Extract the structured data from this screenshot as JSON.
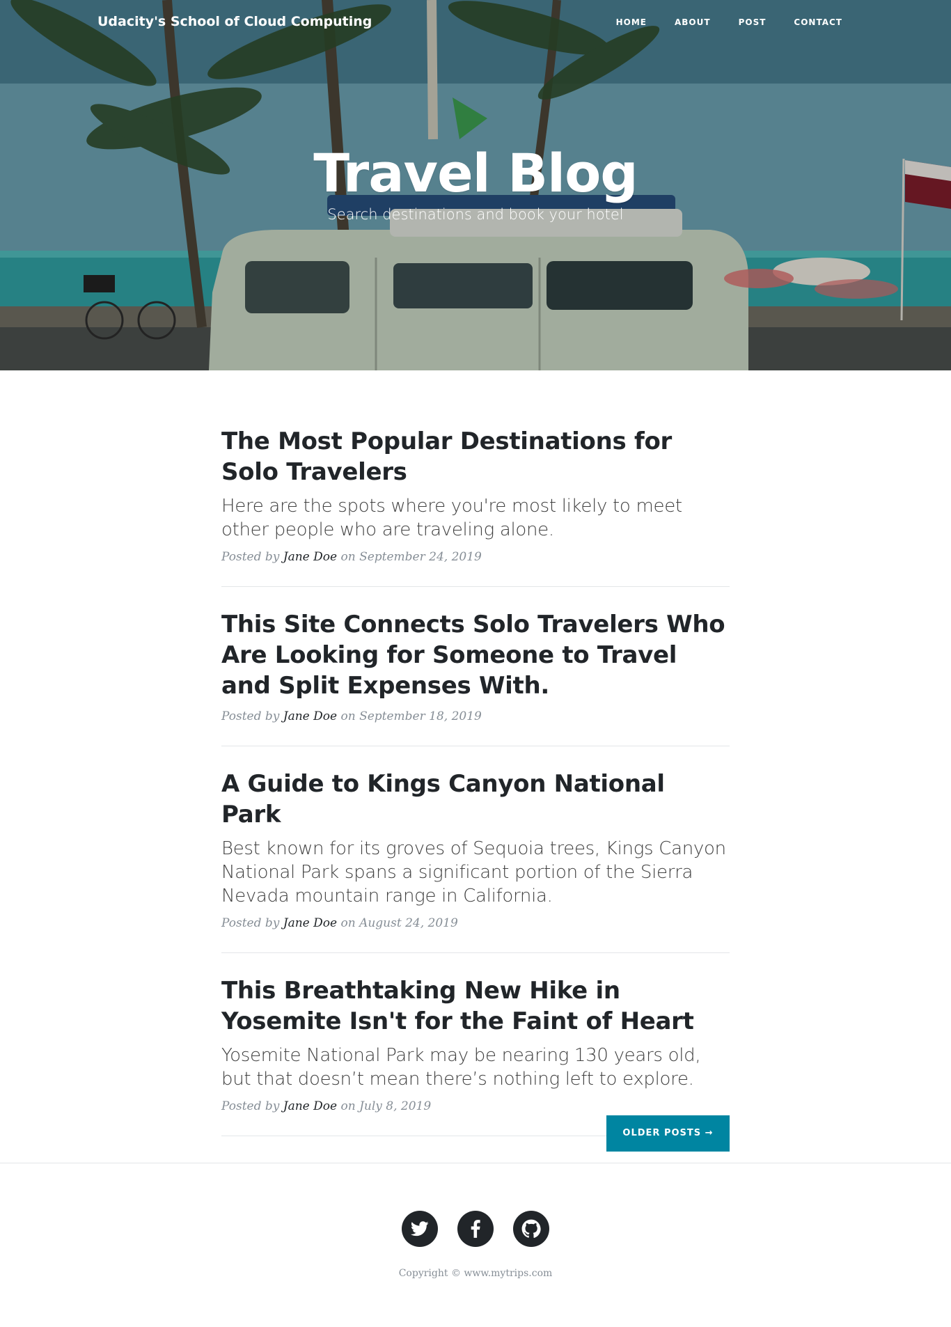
{
  "navbar": {
    "brand": "Udacity's School of Cloud Computing",
    "links": [
      "HOME",
      "ABOUT",
      "POST",
      "CONTACT"
    ]
  },
  "hero": {
    "title": "Travel Blog",
    "subtitle": "Search destinations and book your hotel"
  },
  "posts": [
    {
      "title": "The Most Popular Destinations for Solo Travelers",
      "subtitle": "Here are the spots where you're most likely to meet other people who are traveling alone.",
      "posted_by": "Posted by",
      "author": "Jane Doe",
      "on": "on September 24, 2019"
    },
    {
      "title": "This Site Connects Solo Travelers Who Are Looking for Someone to Travel and Split Expenses With.",
      "subtitle": "",
      "posted_by": "Posted by",
      "author": "Jane Doe",
      "on": "on September 18, 2019"
    },
    {
      "title": "A Guide to Kings Canyon National Park",
      "subtitle": "Best known for its groves of Sequoia trees, Kings Canyon National Park spans a significant portion of the Sierra Nevada mountain range in California.",
      "posted_by": "Posted by",
      "author": "Jane Doe",
      "on": "on August 24, 2019"
    },
    {
      "title": "This Breathtaking New Hike in Yosemite Isn't for the Faint of Heart",
      "subtitle": "Yosemite National Park may be nearing 130 years old, but that doesn’t mean there’s nothing left to explore.",
      "posted_by": "Posted by",
      "author": "Jane Doe",
      "on": "on July 8, 2019"
    }
  ],
  "pager": {
    "older_label": "OLDER POSTS →"
  },
  "footer": {
    "social": [
      "twitter-icon",
      "facebook-icon",
      "github-icon"
    ],
    "copyright": "Copyright © www.mytrips.com"
  },
  "colors": {
    "accent": "#0085a1",
    "text": "#212529",
    "meta": "#868e96"
  }
}
